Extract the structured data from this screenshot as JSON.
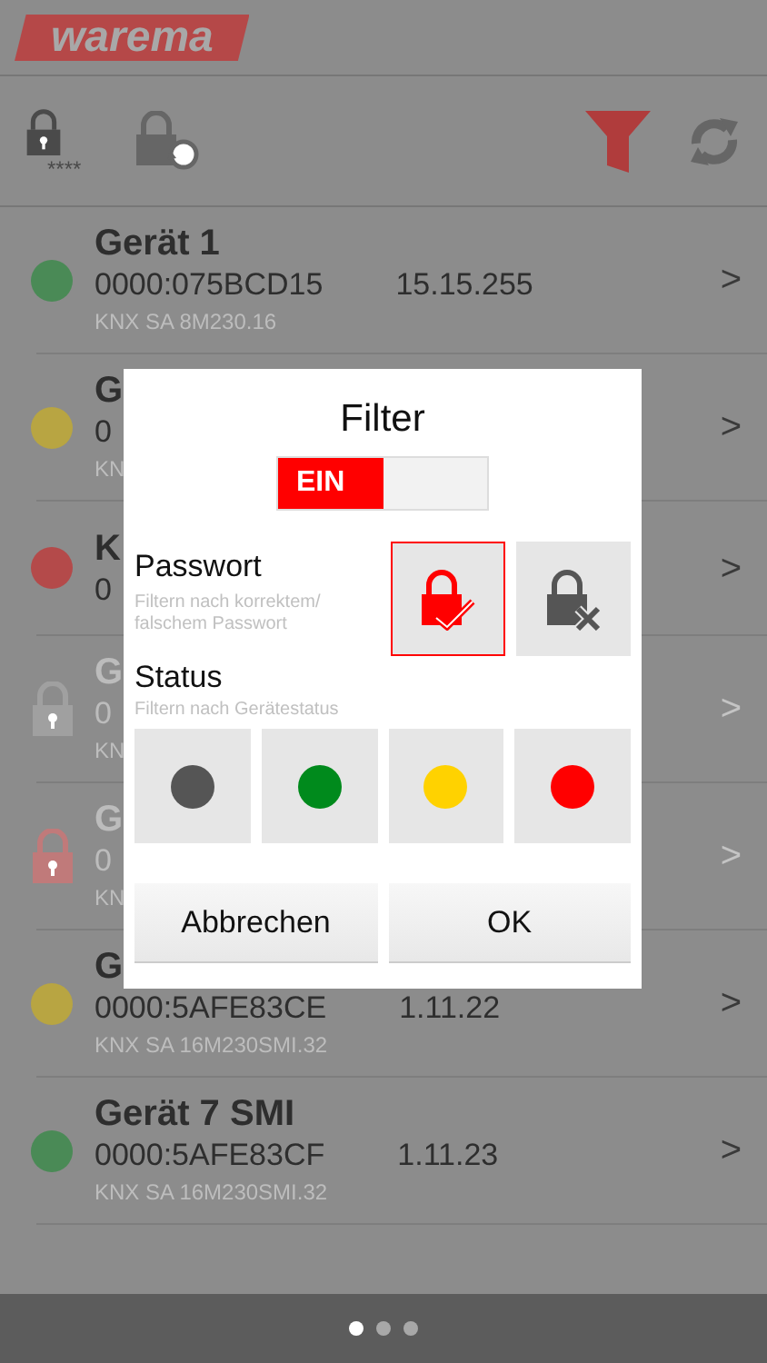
{
  "header": {
    "logo": "warema"
  },
  "toolbar": {
    "password_stars": "****"
  },
  "devices": [
    {
      "kind": "dot",
      "color": "#4a8a56",
      "title": "Gerät 1",
      "address": "0000:075BCD15",
      "version": "15.15.255",
      "model": "KNX SA 8M230.16",
      "disabled": false,
      "chevron": ">"
    },
    {
      "kind": "dot",
      "color": "#b8a542",
      "title": "G",
      "address": "0",
      "model": "KN",
      "disabled": false,
      "chevron": ">"
    },
    {
      "kind": "dot",
      "color": "#b44a4a",
      "title": "K",
      "address": "0",
      "disabled": false,
      "chevron": ">"
    },
    {
      "kind": "lock",
      "color": "#a0a0a0",
      "title": "G",
      "address": "0",
      "model": "KN",
      "disabled": true,
      "chevron": ">"
    },
    {
      "kind": "lock",
      "color": "#c07a7a",
      "title": "G",
      "address": "0",
      "model": "KN",
      "disabled": true,
      "chevron": ">"
    },
    {
      "kind": "dot",
      "color": "#b8a542",
      "title": "G",
      "address": "0000:5AFE83CE",
      "version": "1.11.22",
      "model": "KNX SA 16M230SMI.32",
      "disabled": false,
      "chevron": ">"
    },
    {
      "kind": "dot",
      "color": "#4a8a56",
      "title": "Gerät 7 SMI",
      "address": "0000:5AFE83CF",
      "version": "1.11.23",
      "model": "KNX SA 16M230SMI.32",
      "disabled": false,
      "chevron": ">"
    }
  ],
  "dialog": {
    "title": "Filter",
    "toggle": {
      "label": "EIN",
      "on": true
    },
    "password": {
      "title": "Passwort",
      "hint": "Filtern nach korrektem/ falschem Passwort",
      "options": [
        {
          "kind": "correct",
          "selected": true
        },
        {
          "kind": "wrong",
          "selected": false
        }
      ]
    },
    "status": {
      "title": "Status",
      "hint": "Filtern nach Gerätestatus",
      "options": [
        {
          "color": "#555555",
          "selected": false
        },
        {
          "color": "#008a1c",
          "selected": false
        },
        {
          "color": "#ffd200",
          "selected": false
        },
        {
          "color": "#ff0000",
          "selected": false
        }
      ]
    },
    "buttons": [
      "Abbrechen",
      "OK"
    ]
  },
  "pager": [
    {
      "selected": true
    },
    {
      "selected": false
    },
    {
      "selected": false
    }
  ]
}
